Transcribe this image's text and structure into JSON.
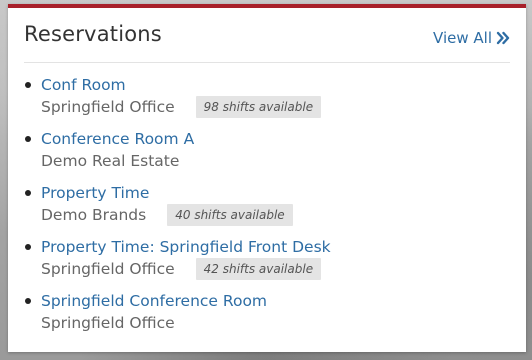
{
  "widget": {
    "title": "Reservations",
    "view_all_label": "View All",
    "view_all_icon": "double-chevron-right-icon",
    "accent_color": "#a8202a",
    "link_color": "#2e6da4"
  },
  "reservations": [
    {
      "name": "Conf Room",
      "location": "Springfield Office",
      "shifts": "98 shifts available"
    },
    {
      "name": "Conference Room A",
      "location": "Demo Real Estate",
      "shifts": ""
    },
    {
      "name": "Property Time",
      "location": "Demo Brands",
      "shifts": "40 shifts available"
    },
    {
      "name": "Property Time: Springfield Front Desk",
      "location": "Springfield Office",
      "shifts": "42 shifts available"
    },
    {
      "name": "Springfield Conference Room",
      "location": "Springfield Office",
      "shifts": ""
    }
  ]
}
